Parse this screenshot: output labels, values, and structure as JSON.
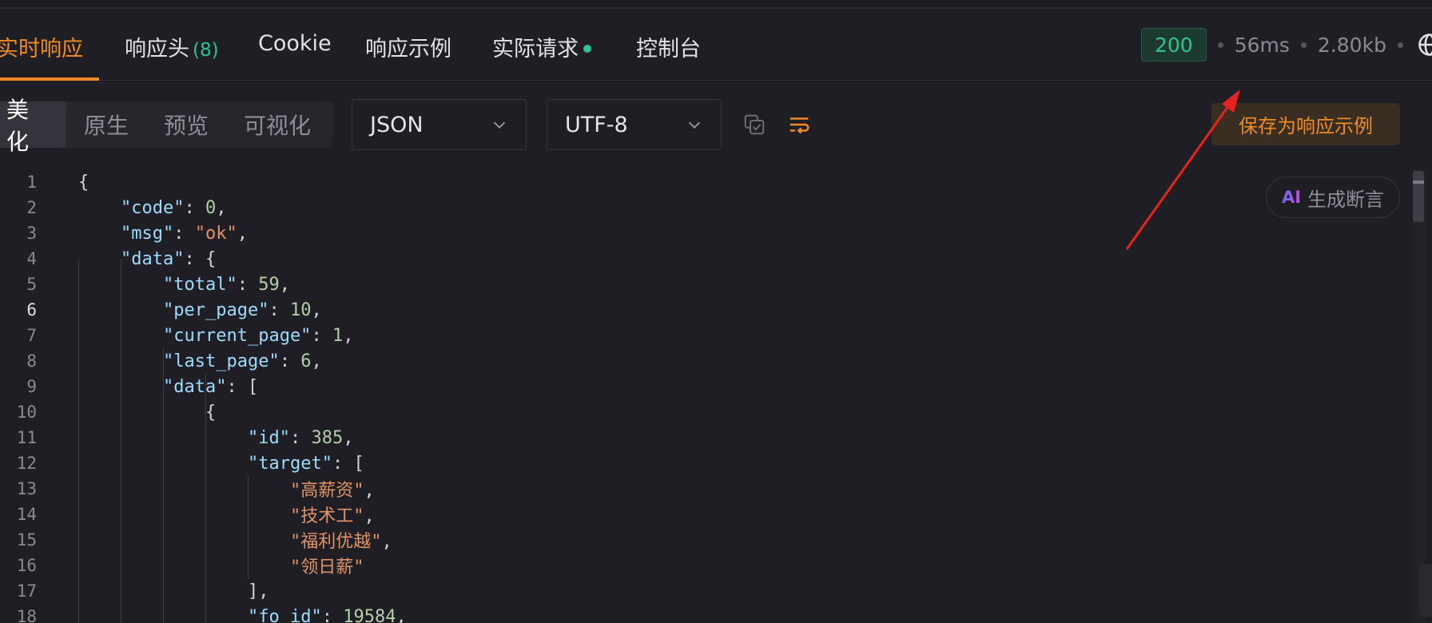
{
  "tabs": [
    {
      "label": "实时响应"
    },
    {
      "label": "响应头",
      "count": "(8)"
    },
    {
      "label": "Cookie"
    },
    {
      "label": "响应示例"
    },
    {
      "label": "实际请求"
    },
    {
      "label": "控制台"
    }
  ],
  "status": {
    "code": "200",
    "time": "56ms",
    "size": "2.80kb"
  },
  "view_modes": [
    "美化",
    "原生",
    "预览",
    "可视化"
  ],
  "format_select": {
    "value": "JSON"
  },
  "encoding_select": {
    "value": "UTF-8"
  },
  "save_button": "保存为响应示例",
  "ai_button": {
    "mark": "AI",
    "label": "生成断言"
  },
  "colors": {
    "accent": "#f08a24",
    "success": "#2fc48d",
    "annotation_arrow": "#e8231f"
  },
  "icons": [
    "copy-icon",
    "wrap-icon",
    "globe-icon",
    "chevron-down-icon"
  ],
  "code_lines": [
    {
      "n": "1",
      "tokens": [
        {
          "t": "{",
          "c": "p"
        }
      ]
    },
    {
      "n": "2",
      "tokens": [
        {
          "t": "\"code\"",
          "c": "k"
        },
        {
          "t": ": ",
          "c": "p"
        },
        {
          "t": "0",
          "c": "n"
        },
        {
          "t": ",",
          "c": "p"
        }
      ]
    },
    {
      "n": "3",
      "tokens": [
        {
          "t": "\"msg\"",
          "c": "k"
        },
        {
          "t": ": ",
          "c": "p"
        },
        {
          "t": "\"ok\"",
          "c": "s"
        },
        {
          "t": ",",
          "c": "p"
        }
      ]
    },
    {
      "n": "4",
      "tokens": [
        {
          "t": "\"data\"",
          "c": "k"
        },
        {
          "t": ": {",
          "c": "p"
        }
      ]
    },
    {
      "n": "5",
      "tokens": [
        {
          "t": "\"total\"",
          "c": "k"
        },
        {
          "t": ": ",
          "c": "p"
        },
        {
          "t": "59",
          "c": "n"
        },
        {
          "t": ",",
          "c": "p"
        }
      ]
    },
    {
      "n": "6",
      "tokens": [
        {
          "t": "\"per_page\"",
          "c": "k"
        },
        {
          "t": ": ",
          "c": "p"
        },
        {
          "t": "10",
          "c": "n"
        },
        {
          "t": ",",
          "c": "p"
        }
      ]
    },
    {
      "n": "7",
      "tokens": [
        {
          "t": "\"current_page\"",
          "c": "k"
        },
        {
          "t": ": ",
          "c": "p"
        },
        {
          "t": "1",
          "c": "n"
        },
        {
          "t": ",",
          "c": "p"
        }
      ]
    },
    {
      "n": "8",
      "tokens": [
        {
          "t": "\"last_page\"",
          "c": "k"
        },
        {
          "t": ": ",
          "c": "p"
        },
        {
          "t": "6",
          "c": "n"
        },
        {
          "t": ",",
          "c": "p"
        }
      ]
    },
    {
      "n": "9",
      "tokens": [
        {
          "t": "\"data\"",
          "c": "k"
        },
        {
          "t": ": [",
          "c": "p"
        }
      ]
    },
    {
      "n": "10",
      "tokens": [
        {
          "t": "{",
          "c": "p"
        }
      ]
    },
    {
      "n": "11",
      "tokens": [
        {
          "t": "\"id\"",
          "c": "k"
        },
        {
          "t": ": ",
          "c": "p"
        },
        {
          "t": "385",
          "c": "n"
        },
        {
          "t": ",",
          "c": "p"
        }
      ]
    },
    {
      "n": "12",
      "tokens": [
        {
          "t": "\"target\"",
          "c": "k"
        },
        {
          "t": ": [",
          "c": "p"
        }
      ]
    },
    {
      "n": "13",
      "tokens": [
        {
          "t": "\"高薪资\"",
          "c": "s"
        },
        {
          "t": ",",
          "c": "p"
        }
      ]
    },
    {
      "n": "14",
      "tokens": [
        {
          "t": "\"技术工\"",
          "c": "s"
        },
        {
          "t": ",",
          "c": "p"
        }
      ]
    },
    {
      "n": "15",
      "tokens": [
        {
          "t": "\"福利优越\"",
          "c": "s"
        },
        {
          "t": ",",
          "c": "p"
        }
      ]
    },
    {
      "n": "16",
      "tokens": [
        {
          "t": "\"领日薪\"",
          "c": "s"
        }
      ]
    },
    {
      "n": "17",
      "tokens": [
        {
          "t": "],",
          "c": "p"
        }
      ]
    },
    {
      "n": "18",
      "tokens": [
        {
          "t": "\"fo_id\"",
          "c": "k"
        },
        {
          "t": ": ",
          "c": "p"
        },
        {
          "t": "19584",
          "c": "n"
        },
        {
          "t": ",",
          "c": "p"
        }
      ]
    }
  ]
}
